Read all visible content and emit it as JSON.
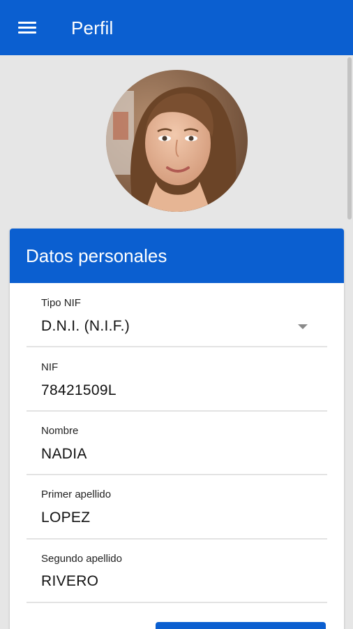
{
  "appbar": {
    "title": "Perfil",
    "menu_icon": "menu-icon"
  },
  "profile": {
    "avatar_icon": "avatar-photo"
  },
  "card": {
    "title": "Datos personales",
    "fields": [
      {
        "label": "Tipo NIF",
        "value": "D.N.I. (N.I.F.)"
      },
      {
        "label": "NIF",
        "value": "78421509L"
      },
      {
        "label": "Nombre",
        "value": "NADIA"
      },
      {
        "label": "Primer apellido",
        "value": "LOPEZ"
      },
      {
        "label": "Segundo apellido",
        "value": "RIVERO"
      }
    ]
  },
  "colors": {
    "primary": "#0b5fd0",
    "background": "#e6e6e6",
    "card": "#ffffff",
    "divider": "#e3e3e3"
  }
}
